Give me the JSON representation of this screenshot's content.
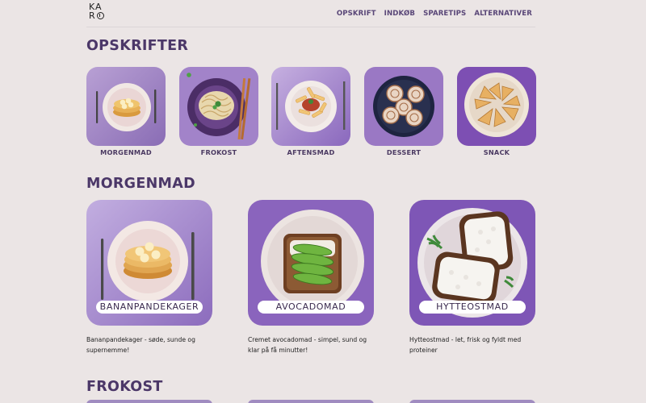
{
  "brand": {
    "logo_line1": "KA",
    "logo_line2": "R"
  },
  "nav": [
    "OPSKRIFT",
    "INDKØB",
    "SPARETIPS",
    "ALTERNATIVER"
  ],
  "sections": {
    "recipes_title": "OPSKRIFTER",
    "breakfast_title": "MORGENMAD",
    "lunch_title": "FROKOST"
  },
  "categories": [
    {
      "label": "MORGENMAD",
      "icon": "pancake-plate"
    },
    {
      "label": "FROKOST",
      "icon": "pasta-bowl"
    },
    {
      "label": "AFTENSMAD",
      "icon": "penne-plate"
    },
    {
      "label": "DESSERT",
      "icon": "cinnamon-rolls"
    },
    {
      "label": "SNACK",
      "icon": "potato-wedges"
    }
  ],
  "breakfast_cards": [
    {
      "title": "BANANPANDEKAGER",
      "description": "Bananpandekager - søde, sunde og supernemme!"
    },
    {
      "title": "AVOCADOMAD",
      "description": "Cremet avocadomad - simpel, sund og klar på få minutter!"
    },
    {
      "title": "HYTTEOSTMAD",
      "description": "Hytteostmad - let, frisk og fyldt med proteiner"
    }
  ],
  "colors": {
    "background": "#ebe5e5",
    "heading": "#4b3768",
    "tile_purple": "#8e6bbd"
  }
}
